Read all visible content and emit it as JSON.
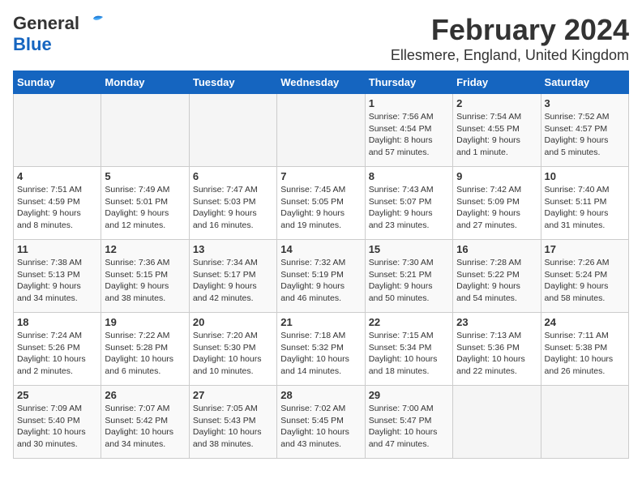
{
  "header": {
    "logo_line1": "General",
    "logo_line2": "Blue",
    "title": "February 2024",
    "subtitle": "Ellesmere, England, United Kingdom"
  },
  "weekdays": [
    "Sunday",
    "Monday",
    "Tuesday",
    "Wednesday",
    "Thursday",
    "Friday",
    "Saturday"
  ],
  "weeks": [
    [
      {
        "day": "",
        "info": ""
      },
      {
        "day": "",
        "info": ""
      },
      {
        "day": "",
        "info": ""
      },
      {
        "day": "",
        "info": ""
      },
      {
        "day": "1",
        "info": "Sunrise: 7:56 AM\nSunset: 4:54 PM\nDaylight: 8 hours\nand 57 minutes."
      },
      {
        "day": "2",
        "info": "Sunrise: 7:54 AM\nSunset: 4:55 PM\nDaylight: 9 hours\nand 1 minute."
      },
      {
        "day": "3",
        "info": "Sunrise: 7:52 AM\nSunset: 4:57 PM\nDaylight: 9 hours\nand 5 minutes."
      }
    ],
    [
      {
        "day": "4",
        "info": "Sunrise: 7:51 AM\nSunset: 4:59 PM\nDaylight: 9 hours\nand 8 minutes."
      },
      {
        "day": "5",
        "info": "Sunrise: 7:49 AM\nSunset: 5:01 PM\nDaylight: 9 hours\nand 12 minutes."
      },
      {
        "day": "6",
        "info": "Sunrise: 7:47 AM\nSunset: 5:03 PM\nDaylight: 9 hours\nand 16 minutes."
      },
      {
        "day": "7",
        "info": "Sunrise: 7:45 AM\nSunset: 5:05 PM\nDaylight: 9 hours\nand 19 minutes."
      },
      {
        "day": "8",
        "info": "Sunrise: 7:43 AM\nSunset: 5:07 PM\nDaylight: 9 hours\nand 23 minutes."
      },
      {
        "day": "9",
        "info": "Sunrise: 7:42 AM\nSunset: 5:09 PM\nDaylight: 9 hours\nand 27 minutes."
      },
      {
        "day": "10",
        "info": "Sunrise: 7:40 AM\nSunset: 5:11 PM\nDaylight: 9 hours\nand 31 minutes."
      }
    ],
    [
      {
        "day": "11",
        "info": "Sunrise: 7:38 AM\nSunset: 5:13 PM\nDaylight: 9 hours\nand 34 minutes."
      },
      {
        "day": "12",
        "info": "Sunrise: 7:36 AM\nSunset: 5:15 PM\nDaylight: 9 hours\nand 38 minutes."
      },
      {
        "day": "13",
        "info": "Sunrise: 7:34 AM\nSunset: 5:17 PM\nDaylight: 9 hours\nand 42 minutes."
      },
      {
        "day": "14",
        "info": "Sunrise: 7:32 AM\nSunset: 5:19 PM\nDaylight: 9 hours\nand 46 minutes."
      },
      {
        "day": "15",
        "info": "Sunrise: 7:30 AM\nSunset: 5:21 PM\nDaylight: 9 hours\nand 50 minutes."
      },
      {
        "day": "16",
        "info": "Sunrise: 7:28 AM\nSunset: 5:22 PM\nDaylight: 9 hours\nand 54 minutes."
      },
      {
        "day": "17",
        "info": "Sunrise: 7:26 AM\nSunset: 5:24 PM\nDaylight: 9 hours\nand 58 minutes."
      }
    ],
    [
      {
        "day": "18",
        "info": "Sunrise: 7:24 AM\nSunset: 5:26 PM\nDaylight: 10 hours\nand 2 minutes."
      },
      {
        "day": "19",
        "info": "Sunrise: 7:22 AM\nSunset: 5:28 PM\nDaylight: 10 hours\nand 6 minutes."
      },
      {
        "day": "20",
        "info": "Sunrise: 7:20 AM\nSunset: 5:30 PM\nDaylight: 10 hours\nand 10 minutes."
      },
      {
        "day": "21",
        "info": "Sunrise: 7:18 AM\nSunset: 5:32 PM\nDaylight: 10 hours\nand 14 minutes."
      },
      {
        "day": "22",
        "info": "Sunrise: 7:15 AM\nSunset: 5:34 PM\nDaylight: 10 hours\nand 18 minutes."
      },
      {
        "day": "23",
        "info": "Sunrise: 7:13 AM\nSunset: 5:36 PM\nDaylight: 10 hours\nand 22 minutes."
      },
      {
        "day": "24",
        "info": "Sunrise: 7:11 AM\nSunset: 5:38 PM\nDaylight: 10 hours\nand 26 minutes."
      }
    ],
    [
      {
        "day": "25",
        "info": "Sunrise: 7:09 AM\nSunset: 5:40 PM\nDaylight: 10 hours\nand 30 minutes."
      },
      {
        "day": "26",
        "info": "Sunrise: 7:07 AM\nSunset: 5:42 PM\nDaylight: 10 hours\nand 34 minutes."
      },
      {
        "day": "27",
        "info": "Sunrise: 7:05 AM\nSunset: 5:43 PM\nDaylight: 10 hours\nand 38 minutes."
      },
      {
        "day": "28",
        "info": "Sunrise: 7:02 AM\nSunset: 5:45 PM\nDaylight: 10 hours\nand 43 minutes."
      },
      {
        "day": "29",
        "info": "Sunrise: 7:00 AM\nSunset: 5:47 PM\nDaylight: 10 hours\nand 47 minutes."
      },
      {
        "day": "",
        "info": ""
      },
      {
        "day": "",
        "info": ""
      }
    ]
  ]
}
